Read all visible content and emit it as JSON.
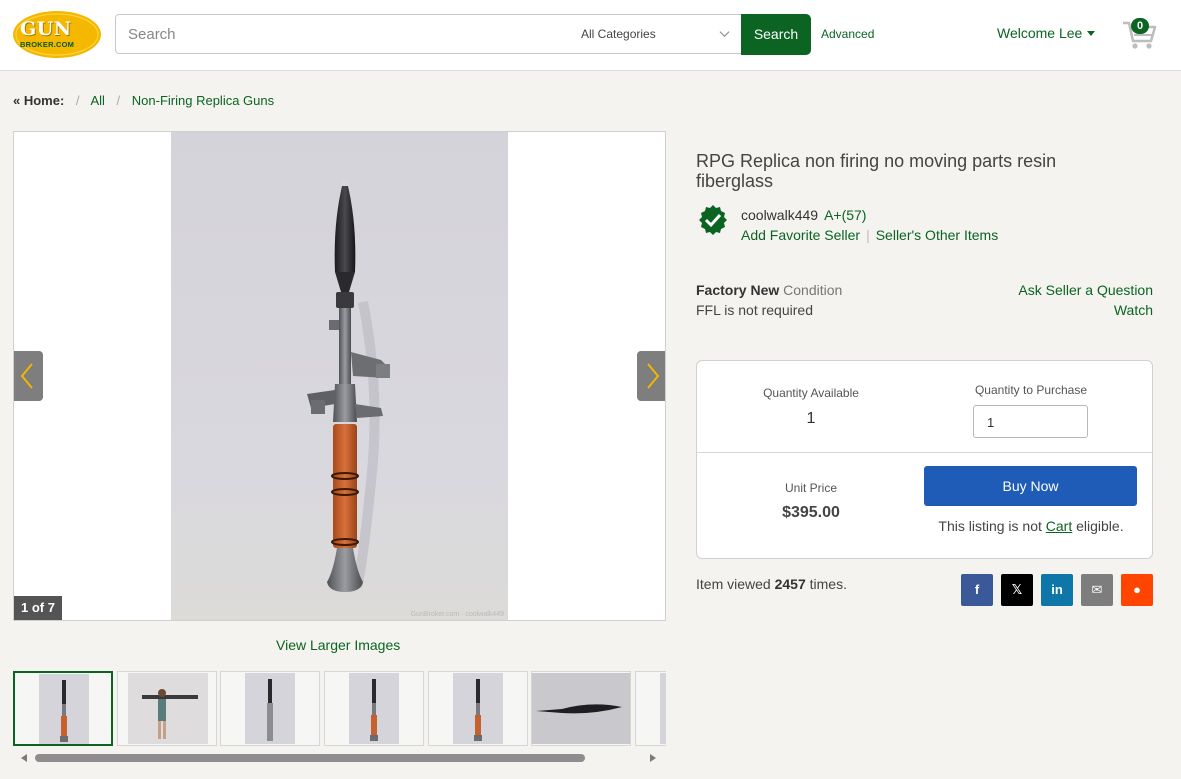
{
  "header": {
    "logo_top": "GUN",
    "logo_bottom": "BROKER.COM",
    "search_placeholder": "Search",
    "category_selected": "All Categories",
    "search_button": "Search",
    "advanced_link": "Advanced",
    "welcome": "Welcome Lee",
    "cart_count": "0"
  },
  "breadcrumb": {
    "home": "« Home:",
    "items": [
      "All",
      "Non-Firing Replica Guns"
    ]
  },
  "gallery": {
    "counter": "1 of 7",
    "watermark": "GunBroker.com · coolwalk449",
    "view_larger": "View Larger Images",
    "thumbnail_count": 7
  },
  "listing": {
    "title": "RPG Replica non firing no moving parts resin fiberglass",
    "seller_name": "coolwalk449",
    "seller_rating": "A+(57)",
    "add_favorite": "Add Favorite Seller",
    "other_items": "Seller's Other Items",
    "condition_value": "Factory New",
    "condition_label": "Condition",
    "ffl": "FFL is not required",
    "ask_seller": "Ask Seller a Question",
    "watch": "Watch"
  },
  "buybox": {
    "qty_available_label": "Quantity Available",
    "qty_available": "1",
    "qty_purchase_label": "Quantity to Purchase",
    "qty_purchase_value": "1",
    "unit_price_label": "Unit Price",
    "unit_price": "$395.00",
    "buy_now": "Buy Now",
    "cart_note_pre": "This listing is not",
    "cart_note_link": "Cart",
    "cart_note_post": "eligible."
  },
  "stats": {
    "views_pre": "Item viewed",
    "views_count": "2457",
    "views_post": "times."
  },
  "share": [
    {
      "name": "facebook",
      "glyph": "f",
      "color": "#3b5998"
    },
    {
      "name": "x",
      "glyph": "𝕏",
      "color": "#000000"
    },
    {
      "name": "linkedin",
      "glyph": "in",
      "color": "#0e76a8"
    },
    {
      "name": "email",
      "glyph": "✉",
      "color": "#7d7d7d"
    },
    {
      "name": "reddit",
      "glyph": "●",
      "color": "#ff4500"
    }
  ],
  "colors": {
    "brand_green": "#0b6421",
    "buy_blue": "#1e5cb8",
    "logo_yellow": "#f5b800"
  }
}
